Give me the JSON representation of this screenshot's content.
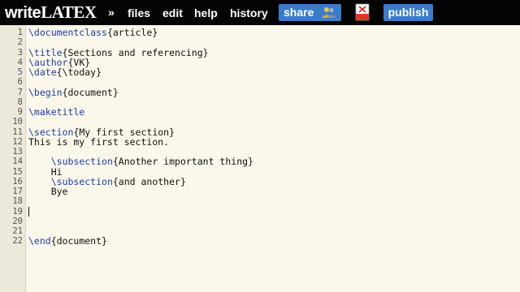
{
  "app": {
    "logo_prefix": "write",
    "logo_suffix": "LATEX"
  },
  "menu": {
    "chevron": "»",
    "files": "files",
    "edit": "edit",
    "help": "help",
    "history": "history",
    "share": "share",
    "publish": "publish"
  },
  "editor": {
    "line_numbers": [
      "1",
      "2",
      "3",
      "4",
      "5",
      "6",
      "7",
      "8",
      "9",
      "10",
      "11",
      "12",
      "13",
      "14",
      "15",
      "16",
      "17",
      "18",
      "19",
      "20",
      "21",
      "22"
    ],
    "lines": [
      {
        "cmd": "\\documentclass",
        "arg": "{article}",
        "indent": ""
      },
      {
        "cmd": "",
        "arg": "",
        "indent": ""
      },
      {
        "cmd": "\\title",
        "arg": "{Sections and referencing}",
        "indent": ""
      },
      {
        "cmd": "\\author",
        "arg": "{VK}",
        "indent": ""
      },
      {
        "cmd": "\\date",
        "arg": "{\\today}",
        "indent": ""
      },
      {
        "cmd": "",
        "arg": "",
        "indent": ""
      },
      {
        "cmd": "\\begin",
        "arg": "{document}",
        "indent": ""
      },
      {
        "cmd": "",
        "arg": "",
        "indent": ""
      },
      {
        "cmd": "\\maketitle",
        "arg": "",
        "indent": ""
      },
      {
        "cmd": "",
        "arg": "",
        "indent": ""
      },
      {
        "cmd": "\\section",
        "arg": "{My first section}",
        "indent": ""
      },
      {
        "cmd": "",
        "arg": "This is my first section.",
        "indent": ""
      },
      {
        "cmd": "",
        "arg": "",
        "indent": ""
      },
      {
        "cmd": "\\subsection",
        "arg": "{Another important thing}",
        "indent": "    "
      },
      {
        "cmd": "",
        "arg": "Hi",
        "indent": "    "
      },
      {
        "cmd": "\\subsection",
        "arg": "{and another}",
        "indent": "    "
      },
      {
        "cmd": "",
        "arg": "Bye",
        "indent": "    "
      },
      {
        "cmd": "",
        "arg": "",
        "indent": ""
      },
      {
        "cmd": "",
        "arg": "",
        "indent": ""
      },
      {
        "cmd": "",
        "arg": "",
        "indent": ""
      },
      {
        "cmd": "",
        "arg": "",
        "indent": ""
      },
      {
        "cmd": "\\end",
        "arg": "{document}",
        "indent": ""
      }
    ],
    "cursor_line": 19
  },
  "colors": {
    "toolbar_bg": "#050505",
    "button_blue": "#3c7cc6",
    "editor_bg": "#fbf7ea",
    "command_blue": "#1b3ea1"
  },
  "icons": {
    "share": "share-people-icon",
    "pdf": "pdf-icon"
  }
}
